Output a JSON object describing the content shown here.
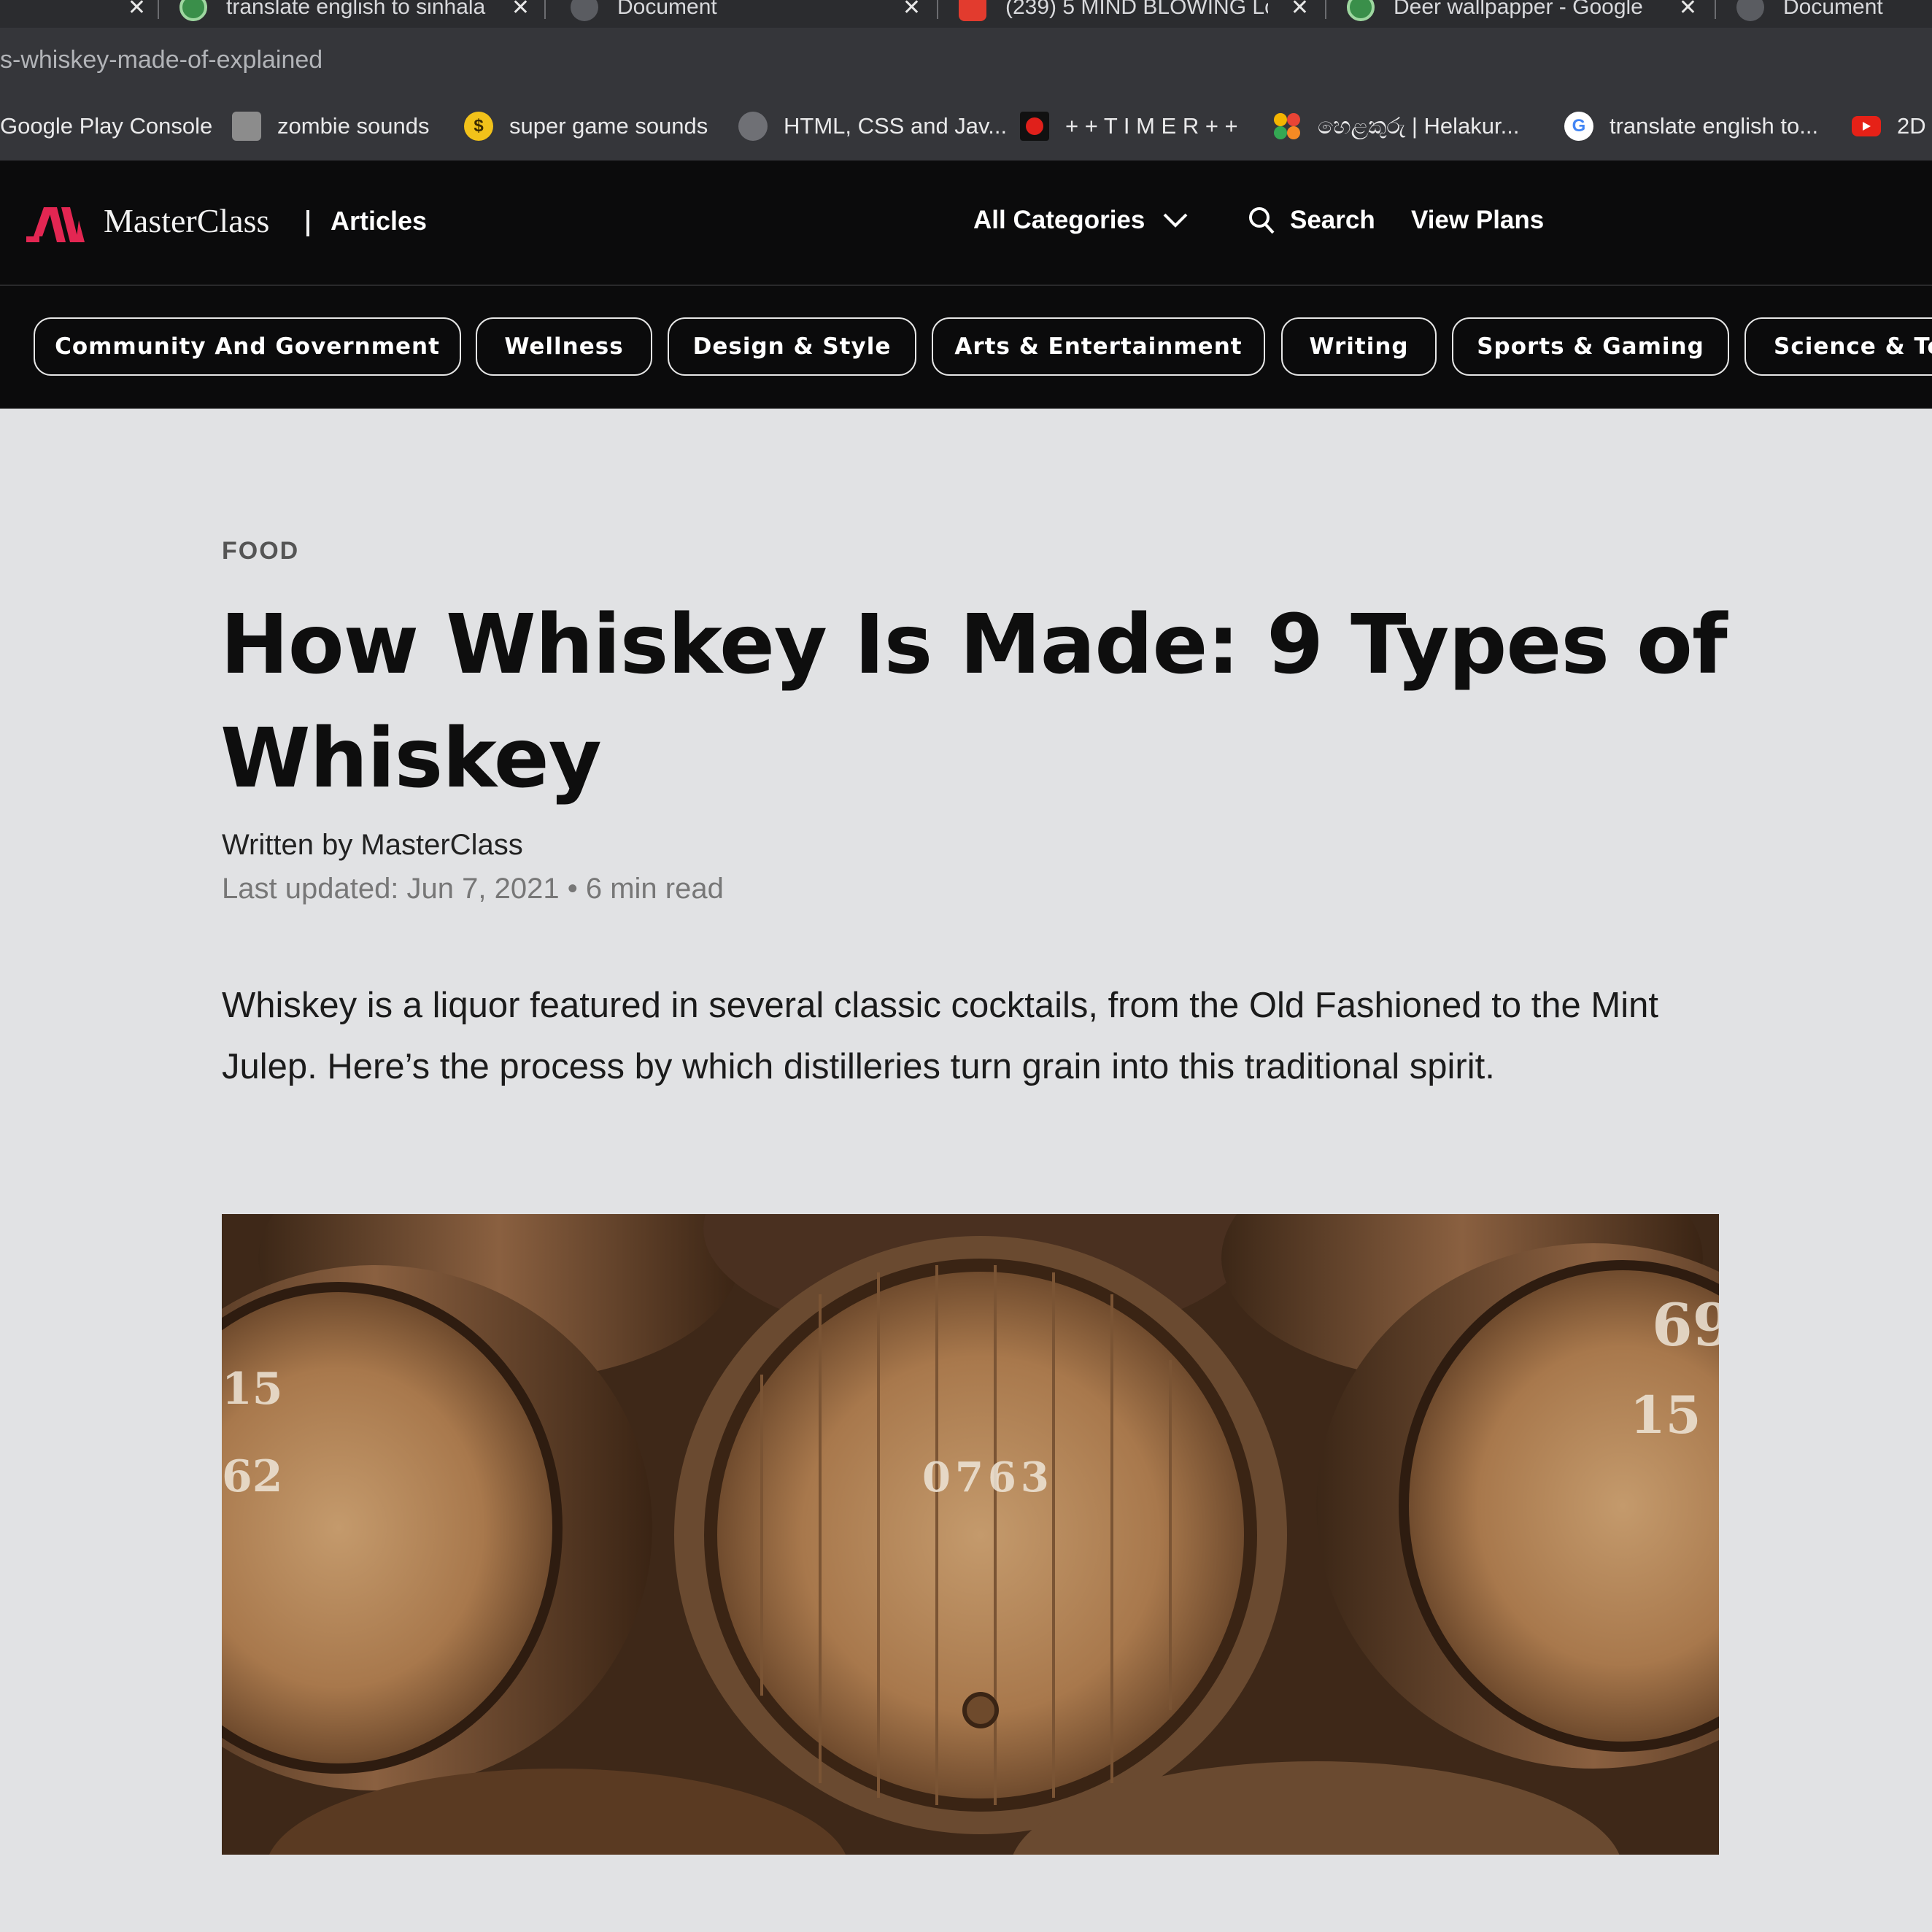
{
  "browser": {
    "tabs": [
      {
        "title": "translate english to sinhala"
      },
      {
        "title": "Document"
      },
      {
        "title": "(239) 5 MIND BLOWING Lo"
      },
      {
        "title": "Deer wallpapper - Google"
      },
      {
        "title": "Document"
      }
    ],
    "url": "s-whiskey-made-of-explained",
    "bookmarks": [
      {
        "label": "Google Play Console",
        "icon": "google-play-icon"
      },
      {
        "label": "zombie sounds",
        "icon": "zombie-icon"
      },
      {
        "label": "super game sounds",
        "icon": "coin-icon",
        "icon_text": "$"
      },
      {
        "label": "HTML, CSS and Jav...",
        "icon": "globe-icon"
      },
      {
        "label": "+ + T I M E R + +",
        "icon": "timer-icon"
      },
      {
        "label": "හෙළකුරු | Helakur...",
        "icon": "helakuru-icon"
      },
      {
        "label": "translate english to...",
        "icon": "google-icon",
        "icon_text": "G"
      },
      {
        "label": "2D",
        "icon": "youtube-icon"
      }
    ]
  },
  "site": {
    "brand": "MasterClass",
    "section": "Articles",
    "nav": {
      "categories": "All Categories",
      "search": "Search",
      "plans": "View Plans"
    },
    "pills": [
      "Community And Government",
      "Wellness",
      "Design & Style",
      "Arts & Entertainment",
      "Writing",
      "Sports & Gaming",
      "Science & Te"
    ],
    "accent_color": "#e32652"
  },
  "article": {
    "category": "FOOD",
    "title": "How Whiskey Is Made: 9 Types of Whiskey",
    "byline": "Written by MasterClass",
    "meta": "Last updated: Jun 7, 2021 • 6 min read",
    "lede": "Whiskey is a liquor featured in several classic cocktails, from the Old Fashioned to the Mint Julep. Here’s the process by which distilleries turn grain into this traditional spirit.",
    "hero_barrel_labels": [
      "15",
      "62",
      "0763",
      "69",
      "15"
    ]
  }
}
